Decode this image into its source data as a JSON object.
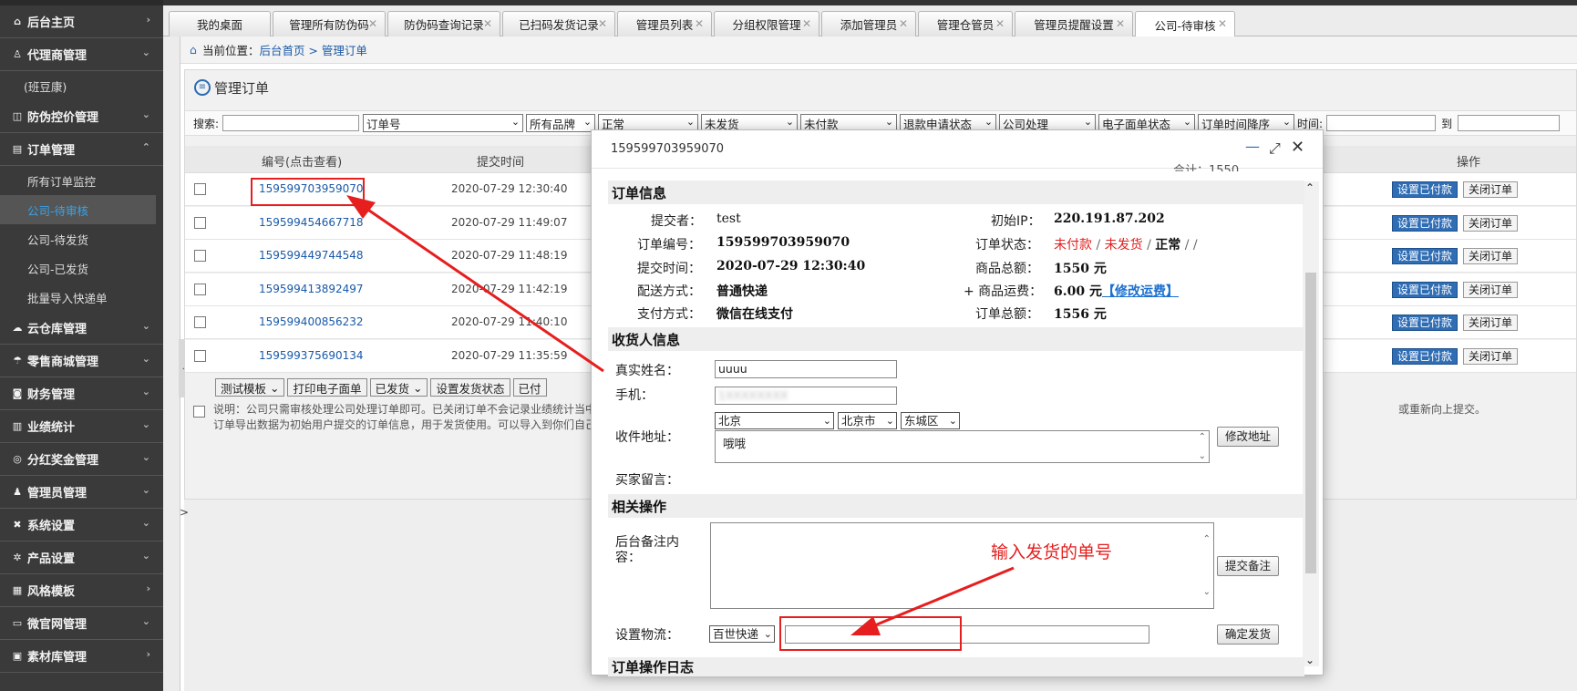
{
  "sidebar": {
    "groups": [
      {
        "icon": "home-icon",
        "glyph": "⌂",
        "label": "后台主页",
        "chevron": "›"
      },
      {
        "icon": "user-icon",
        "glyph": "♙",
        "label": "代理商管理",
        "chevron": "⌄",
        "subitems": [
          {
            "label": "(班豆康)"
          }
        ]
      },
      {
        "icon": "code-icon",
        "glyph": "◫",
        "label": "防伪控价管理",
        "chevron": "⌄"
      },
      {
        "icon": "doc-icon",
        "glyph": "▤",
        "label": "订单管理",
        "chevron": "⌃",
        "subitems": [
          {
            "label": "所有订单监控",
            "active": false
          },
          {
            "label": "公司-待审核",
            "active": true
          },
          {
            "label": "公司-待发货",
            "active": false
          },
          {
            "label": "公司-已发货",
            "active": false
          },
          {
            "label": "批量导入快递单",
            "active": false
          }
        ]
      },
      {
        "icon": "cloud-icon",
        "glyph": "☁",
        "label": "云仓库管理",
        "chevron": "⌄"
      },
      {
        "icon": "shop-icon",
        "glyph": "☂",
        "label": "零售商城管理",
        "chevron": "⌄"
      },
      {
        "icon": "finance-icon",
        "glyph": "◙",
        "label": "财务管理",
        "chevron": "⌄"
      },
      {
        "icon": "chart-icon",
        "glyph": "▥",
        "label": "业绩统计",
        "chevron": "⌄"
      },
      {
        "icon": "coin-icon",
        "glyph": "◎",
        "label": "分红奖金管理",
        "chevron": "⌄"
      },
      {
        "icon": "admin-icon",
        "glyph": "♟",
        "label": "管理员管理",
        "chevron": "⌄"
      },
      {
        "icon": "tools-icon",
        "glyph": "✖",
        "label": "系统设置",
        "chevron": "⌄"
      },
      {
        "icon": "gear-icon",
        "glyph": "✲",
        "label": "产品设置",
        "chevron": "⌄"
      },
      {
        "icon": "template-icon",
        "glyph": "▦",
        "label": "风格模板",
        "chevron": "›"
      },
      {
        "icon": "monitor-icon",
        "glyph": "▭",
        "label": "微官网管理",
        "chevron": "⌄"
      },
      {
        "icon": "media-icon",
        "glyph": "▣",
        "label": "素材库管理",
        "chevron": "›"
      }
    ]
  },
  "tabs": [
    {
      "label": "我的桌面",
      "closable": false
    },
    {
      "label": "管理所有防伪码",
      "closable": true
    },
    {
      "label": "防伪码查询记录",
      "closable": true
    },
    {
      "label": "已扫码发货记录",
      "closable": true
    },
    {
      "label": "管理员列表",
      "closable": true
    },
    {
      "label": "分组权限管理",
      "closable": true
    },
    {
      "label": "添加管理员",
      "closable": true
    },
    {
      "label": "管理仓管员",
      "closable": true
    },
    {
      "label": "管理员提醒设置",
      "closable": true
    },
    {
      "label": "公司-待审核",
      "closable": true,
      "active": true
    }
  ],
  "breadcrumb": {
    "prefix": "当前位置：",
    "path": "后台首页 > 管理订单"
  },
  "panel": {
    "title": "管理订单"
  },
  "filters": {
    "search_label": "搜索:",
    "search_value": "",
    "selects": [
      "订单号",
      "所有品牌",
      "正常",
      "未发货",
      "未付款",
      "退款申请状态",
      "公司处理",
      "电子面单状态",
      "订单时间降序"
    ],
    "time_label": "时间:",
    "to_label": "到"
  },
  "table": {
    "headers": {
      "id": "编号(点击查看)",
      "time": "提交时间",
      "ops": "操作"
    },
    "rows": [
      {
        "id": "159599703959070",
        "time": "2020-07-29 12:30:40"
      },
      {
        "id": "159599454667718",
        "time": "2020-07-29 11:49:07"
      },
      {
        "id": "159599449744548",
        "time": "2020-07-29 11:48:19"
      },
      {
        "id": "159599413892497",
        "time": "2020-07-29 11:42:19"
      },
      {
        "id": "159599400856232",
        "time": "2020-07-29 11:40:10"
      },
      {
        "id": "159599375690134",
        "time": "2020-07-29 11:35:59"
      }
    ],
    "pay_label": "设置已付款",
    "close_label": "关闭订单"
  },
  "bulk_actions": {
    "template_select": "测试模板",
    "print_label": "打印电子面单",
    "shipped_select": "已发货",
    "set_ship_label": "设置发货状态",
    "truncated_label": "已付"
  },
  "notes": {
    "line1": "说明：公司只需审核处理公司处理订单即可。已关闭订单不会记录业绩统计当中",
    "line1_tail": "或重新向上提交。",
    "line2": "订单导出数据为初始用户提交的订单信息，用于发货使用。可以导入到你们自己"
  },
  "collapse_arrow": ">",
  "modal": {
    "title": "159599703959070",
    "clipped_text": "合计：1550",
    "order_info": {
      "section": "订单信息",
      "submitter_label": "提交者：",
      "submitter": "test",
      "ip_label": "初始IP：",
      "ip": "220.191.87.202",
      "order_no_label": "订单编号：",
      "order_no": "159599703959070",
      "status_label": "订单状态：",
      "status_unpaid": "未付款",
      "status_sep1": " / ",
      "status_unshipped": "未发货",
      "status_sep2": " / ",
      "status_normal": "正常",
      "status_tail": " / /",
      "submit_time_label": "提交时间：",
      "submit_time": "2020-07-29 12:30:40",
      "goods_total_label": "商品总额：",
      "goods_total": "1550 元",
      "delivery_label": "配送方式：",
      "delivery": "普通快递",
      "freight_label": "+ 商品运费：",
      "freight": "6.00 元",
      "edit_freight": "【修改运费】",
      "pay_label": "支付方式：",
      "pay": "微信在线支付",
      "order_total_label": "订单总额：",
      "order_total": "1556 元"
    },
    "receiver": {
      "section": "收货人信息",
      "name_label": "真实姓名：",
      "name": "uuuu",
      "phone_label": "手机：",
      "phone": "1XXXXXXXX",
      "address_label": "收件地址：",
      "province": "北京",
      "city": "北京市",
      "district": "东城区",
      "address": "哦哦",
      "edit_address": "修改地址",
      "message_label": "买家留言："
    },
    "ops": {
      "section": "相关操作",
      "remark_label": "后台备注内容：",
      "remark_value": "",
      "submit_remark": "提交备注",
      "logistics_label": "设置物流：",
      "carrier": "百世快递",
      "tracking_no": "",
      "confirm_ship": "确定发货"
    },
    "log_section": "订单操作日志"
  },
  "annotation": {
    "text": "输入发货的单号"
  },
  "colors": {
    "accent": "#2f6db5",
    "alert": "#e02020",
    "annotation": "#e61e1e",
    "sidebar": "#3a3a3a"
  }
}
